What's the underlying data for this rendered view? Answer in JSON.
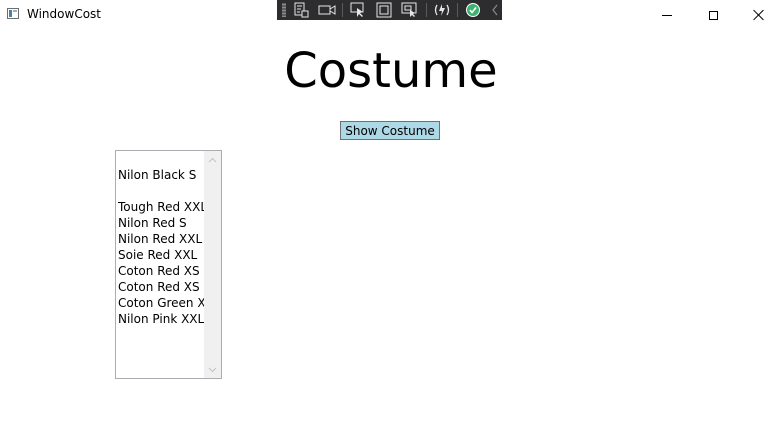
{
  "window": {
    "title": "WindowCost"
  },
  "main": {
    "heading": "Costume",
    "show_button_label": "Show Costume",
    "list_items": [
      "Nilon Black S",
      "",
      "Tough Red XXL",
      "Nilon Red S",
      "Nilon Red XXL",
      "Soie Red XXL",
      "Coton Red XS",
      "Coton Red XS",
      "Coton Green XS",
      "Nilon Pink XXL"
    ]
  },
  "colors": {
    "button_background": "#add8e6",
    "devbar_background": "#2d2d30",
    "check_green": "#3cb371"
  },
  "icons": {
    "devbar": [
      "live-visual-tree-icon",
      "record-icon",
      "select-element-icon",
      "display-layout-adorners-icon",
      "track-focus-icon",
      "hot-reload-icon",
      "check-icon",
      "collapse-chevron-icon"
    ]
  }
}
